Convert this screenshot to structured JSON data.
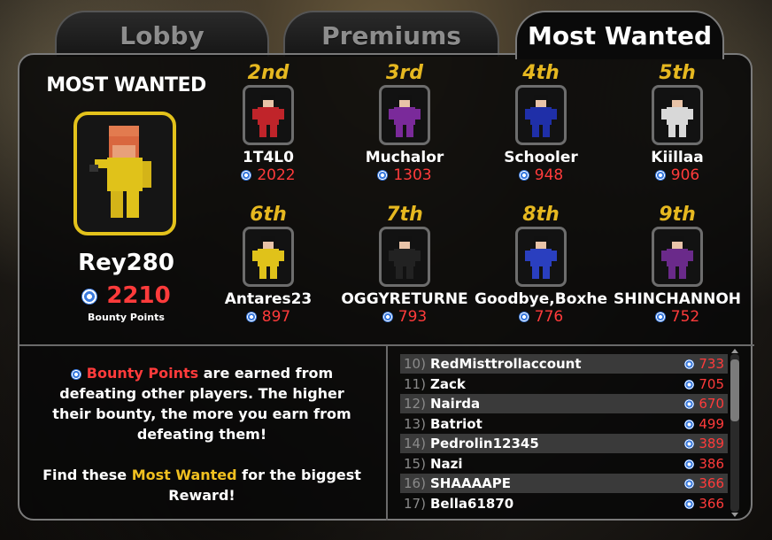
{
  "tabs": [
    {
      "label": "Lobby",
      "active": false
    },
    {
      "label": "Premiums",
      "active": false
    },
    {
      "label": "Most Wanted",
      "active": true
    }
  ],
  "most_wanted": {
    "title": "MOST WANTED",
    "top_player": {
      "name": "Rey280",
      "points": "2210",
      "caption": "Bounty Points",
      "outfit_color": "#e0c21a"
    },
    "ranked": [
      {
        "rank": "2nd",
        "name": "1T4L0",
        "points": "2022",
        "outfit_color": "#c0242a"
      },
      {
        "rank": "3rd",
        "name": "Muchalor",
        "points": "1303",
        "outfit_color": "#7a2a9a"
      },
      {
        "rank": "4th",
        "name": "Schooler",
        "points": "948",
        "outfit_color": "#1f2fa8"
      },
      {
        "rank": "5th",
        "name": "Kiillaa",
        "points": "906",
        "outfit_color": "#d8d8d8"
      },
      {
        "rank": "6th",
        "name": "Antares23",
        "points": "897",
        "outfit_color": "#e0c21a"
      },
      {
        "rank": "7th",
        "name": "OGGYRETURNE",
        "points": "793",
        "outfit_color": "#222222"
      },
      {
        "rank": "8th",
        "name": "Goodbye,Boxhe",
        "points": "776",
        "outfit_color": "#2a3fbf"
      },
      {
        "rank": "9th",
        "name": "SHINCHANNOH",
        "points": "752",
        "outfit_color": "#6a2a8a"
      }
    ]
  },
  "info": {
    "line1_highlight": "Bounty Points",
    "line1_rest": " are earned from defeating other players. The higher their bounty, the more you earn from defeating them!",
    "line2_prefix": "Find these ",
    "line2_highlight": "Most Wanted",
    "line2_rest": " for the biggest Reward!"
  },
  "leaderboard": [
    {
      "index": "10)",
      "name": "RedMisttrollaccount",
      "points": "733"
    },
    {
      "index": "11)",
      "name": "Zack",
      "points": "705"
    },
    {
      "index": "12)",
      "name": "Nairda",
      "points": "670"
    },
    {
      "index": "13)",
      "name": "Batriot",
      "points": "499"
    },
    {
      "index": "14)",
      "name": "Pedrolin12345",
      "points": "389"
    },
    {
      "index": "15)",
      "name": "Nazi",
      "points": "386"
    },
    {
      "index": "16)",
      "name": "SHAAAAPE",
      "points": "366"
    },
    {
      "index": "17)",
      "name": "Bella61870",
      "points": "366"
    }
  ],
  "colors": {
    "points": "#ff3b3b",
    "rank": "#e6b820",
    "highlight_yellow": "#f0c020",
    "top_frame": "#e3c21b"
  }
}
